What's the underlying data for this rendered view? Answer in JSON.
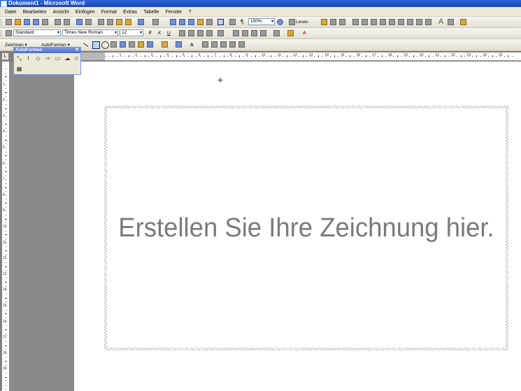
{
  "window": {
    "title": "Dokument1 - Microsoft Word"
  },
  "menu": [
    "Datei",
    "Bearbeiten",
    "Ansicht",
    "Einfügen",
    "Format",
    "Extras",
    "Tabelle",
    "Fenster",
    "?"
  ],
  "toolbar_standard": {
    "zoom": "100%",
    "read_label": "Lesen"
  },
  "toolbar_format": {
    "style": "Standard",
    "font": "Times New Roman",
    "size": "12"
  },
  "toolbar_drawing": {
    "drawing_label": "Zeichnen ▾",
    "autoshapes_label": "AutoFormen ▾"
  },
  "autoshapes_palette": {
    "title": "AutoFormen",
    "close": "✕"
  },
  "ruler_h_numbers": [
    "1",
    "2",
    "3",
    "4",
    "5",
    "6",
    "7",
    "8",
    "9",
    "10",
    "11",
    "12",
    "13",
    "14",
    "15",
    "16",
    "17",
    "18",
    "19",
    "20",
    "21",
    "22",
    "23",
    "24",
    "25"
  ],
  "ruler_v_numbers": [
    "1",
    "2",
    "3",
    "4",
    "5",
    "6",
    "7",
    "8",
    "9",
    "10",
    "11",
    "12",
    "13",
    "14",
    "15",
    "16",
    "17",
    "18",
    "19"
  ],
  "canvas": {
    "placeholder": "Erstellen Sie Ihre Zeichnung hier."
  }
}
